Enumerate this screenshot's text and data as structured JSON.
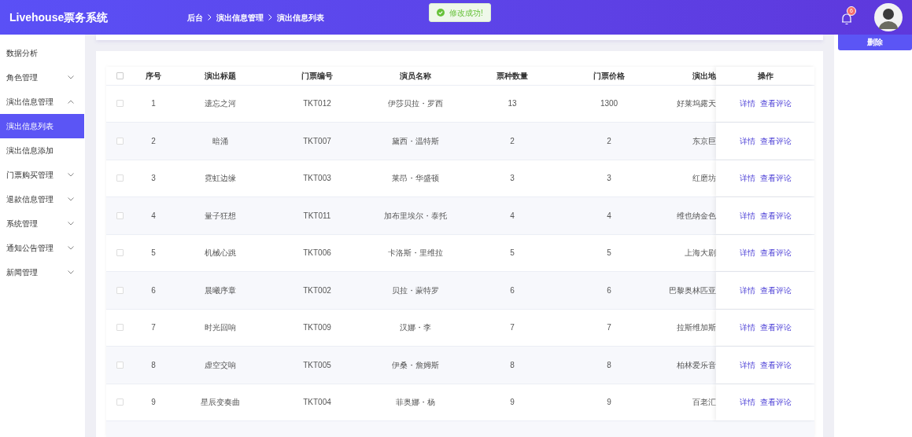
{
  "header": {
    "title": "Livehouse票务系统",
    "breadcrumb": [
      "后台",
      "演出信息管理",
      "演出信息列表"
    ],
    "notification_badge": "6"
  },
  "toast": {
    "message": "修改成功!"
  },
  "sidebar": {
    "items": [
      {
        "label": "数据分析",
        "selected": false
      },
      {
        "label": "角色管理",
        "selected": false,
        "expanded": false
      },
      {
        "label": "演出信息管理",
        "selected": false,
        "expanded": true,
        "children": [
          {
            "label": "演出信息列表",
            "selected": true
          },
          {
            "label": "演出信息添加",
            "selected": false
          }
        ]
      },
      {
        "label": "门票购买管理",
        "selected": false,
        "expanded": false
      },
      {
        "label": "退款信息管理",
        "selected": false,
        "expanded": false
      },
      {
        "label": "系统管理",
        "selected": false,
        "expanded": false
      },
      {
        "label": "通知公告管理",
        "selected": false,
        "expanded": false
      },
      {
        "label": "新闻管理",
        "selected": false,
        "expanded": false
      }
    ]
  },
  "delete_button": "删除",
  "table": {
    "select_all_checked": false,
    "columns": [
      "序号",
      "演出标题",
      "门票编号",
      "演员名称",
      "票种数量",
      "门票价格",
      "演出地",
      "操作"
    ],
    "rows": [
      {
        "checked": false,
        "cells": [
          "1",
          "遗忘之河",
          "TKT012",
          "伊莎贝拉・罗西",
          "13",
          "1300",
          "好莱坞露天"
        ],
        "actions": [
          "详情",
          "查看评论"
        ]
      },
      {
        "checked": false,
        "cells": [
          "2",
          "暗涌",
          "TKT007",
          "黛西・温特斯",
          "2",
          "2",
          "东京巨"
        ],
        "actions": [
          "详情",
          "查看评论"
        ]
      },
      {
        "checked": false,
        "cells": [
          "3",
          "霓虹边缘",
          "TKT003",
          "莱昂・华盛顿",
          "3",
          "3",
          "红磨坊"
        ],
        "actions": [
          "详情",
          "查看评论"
        ]
      },
      {
        "checked": false,
        "cells": [
          "4",
          "量子狂想",
          "TKT011",
          "加布里埃尔・泰托",
          "4",
          "4",
          "维也纳金色"
        ],
        "actions": [
          "详情",
          "查看评论"
        ]
      },
      {
        "checked": false,
        "cells": [
          "5",
          "机械心跳",
          "TKT006",
          "卡洛斯・里维拉",
          "5",
          "5",
          "上海大剧"
        ],
        "actions": [
          "详情",
          "查看评论"
        ]
      },
      {
        "checked": false,
        "cells": [
          "6",
          "晨曦序章",
          "TKT002",
          "贝拉・蒙特罗",
          "6",
          "6",
          "巴黎奥林匹亚"
        ],
        "actions": [
          "详情",
          "查看评论"
        ]
      },
      {
        "checked": false,
        "cells": [
          "7",
          "时光回响",
          "TKT009",
          "汉娜・李",
          "7",
          "7",
          "拉斯维加斯"
        ],
        "actions": [
          "详情",
          "查看评论"
        ]
      },
      {
        "checked": false,
        "cells": [
          "8",
          "虚空交响",
          "TKT005",
          "伊桑・詹姆斯",
          "8",
          "8",
          "柏林爱乐音"
        ],
        "actions": [
          "详情",
          "查看评论"
        ]
      },
      {
        "checked": false,
        "cells": [
          "9",
          "星辰变奏曲",
          "TKT004",
          "菲奥娜・杨",
          "9",
          "9",
          "百老汇"
        ],
        "actions": [
          "详情",
          "查看评论"
        ]
      }
    ]
  }
}
